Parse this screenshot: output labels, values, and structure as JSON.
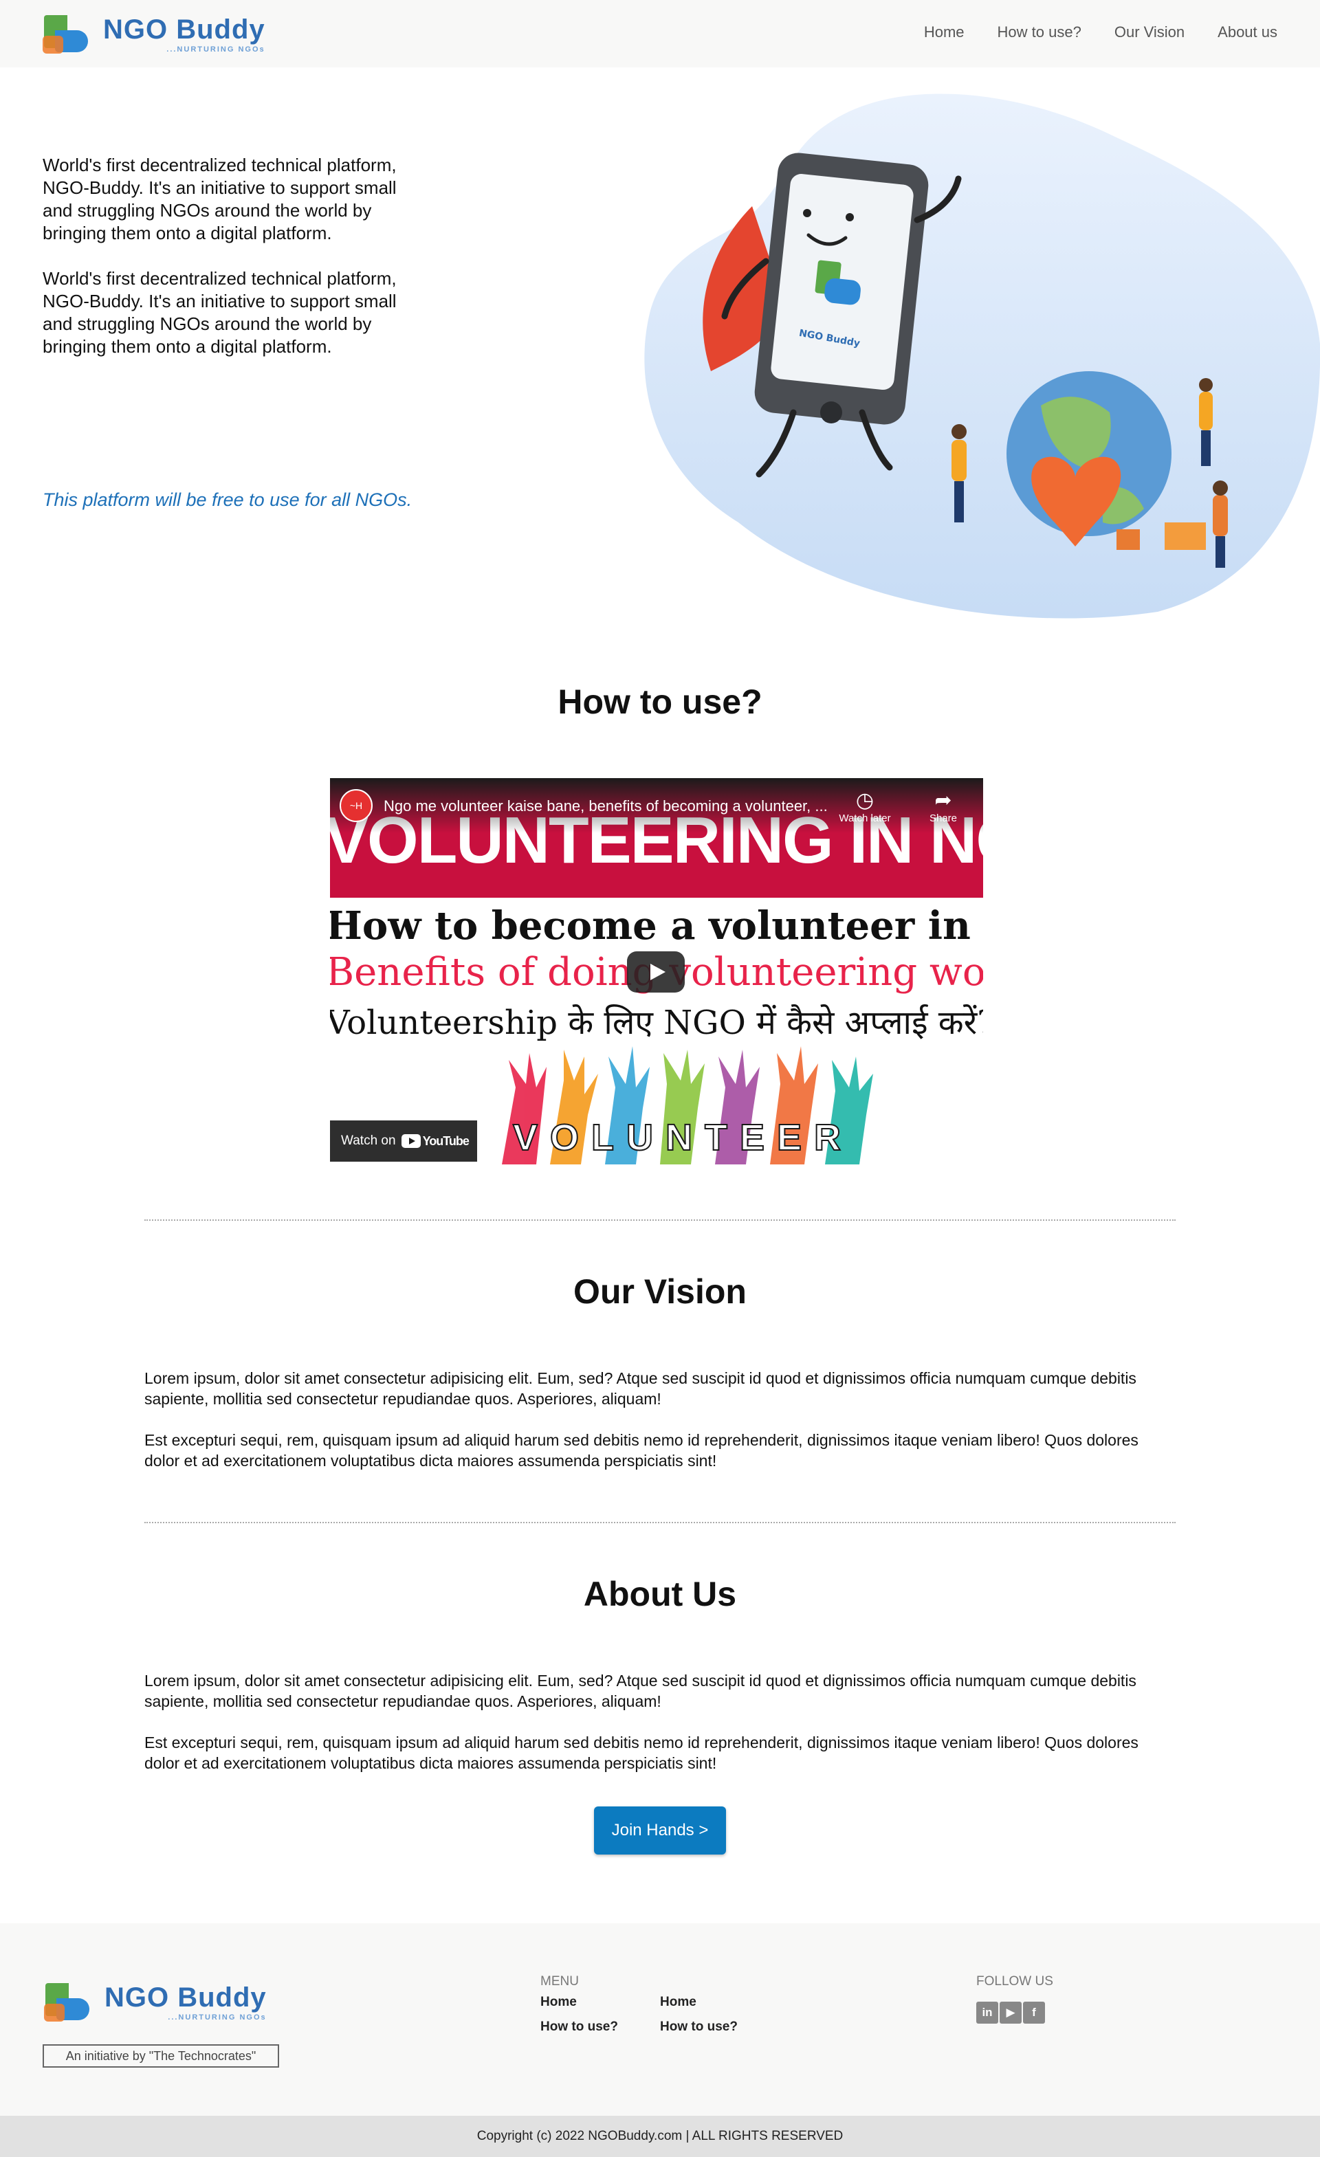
{
  "brand": {
    "name": "NGO Buddy",
    "tagline": "...NURTURING NGOs"
  },
  "nav": {
    "items": [
      {
        "label": "Home"
      },
      {
        "label": "How to use?"
      },
      {
        "label": "Our Vision"
      },
      {
        "label": "About us"
      }
    ]
  },
  "hero": {
    "para1": "World's first decentralized technical platform, NGO-Buddy. It's an initiative to support small and struggling NGOs around the world by bringing them onto a digital platform.",
    "para2": "World's first decentralized technical platform, NGO-Buddy. It's an initiative to support small and struggling NGOs around the world by bringing them onto a digital platform.",
    "free_note": "This platform will be free to use for all NGOs.",
    "phone_brand": "NGO Buddy"
  },
  "how_to_use": {
    "title": "How to use?",
    "video": {
      "title": "Ngo me volunteer kaise bane, benefits of becoming a volunteer, ...",
      "watch_later": "Watch later",
      "share": "Share",
      "headline": "VOLUNTEERING IN NGO",
      "line1": "How to become a volunteer in NGO?",
      "line2": "Benefits of doing volunteering work",
      "line3": "Volunteership के लिए NGO में कैसे अप्लाई करें?",
      "word": "VOLUNTEER",
      "watch_on": "Watch on",
      "youtube": "YouTube"
    }
  },
  "vision": {
    "title": "Our Vision",
    "para1": "Lorem ipsum, dolor sit amet consectetur adipisicing elit. Eum, sed? Atque sed suscipit id quod et dignissimos officia numquam cumque debitis sapiente, mollitia sed consectetur repudiandae quos. Asperiores, aliquam!",
    "para2": "Est excepturi sequi, rem, quisquam ipsum ad aliquid harum sed debitis nemo id reprehenderit, dignissimos itaque veniam libero! Quos dolores dolor et ad exercitationem voluptatibus dicta maiores assumenda perspiciatis sint!"
  },
  "about": {
    "title": "About Us",
    "para1": "Lorem ipsum, dolor sit amet consectetur adipisicing elit. Eum, sed? Atque sed suscipit id quod et dignissimos officia numquam cumque debitis sapiente, mollitia sed consectetur repudiandae quos. Asperiores, aliquam!",
    "para2": "Est excepturi sequi, rem, quisquam ipsum ad aliquid harum sed debitis nemo id reprehenderit, dignissimos itaque veniam libero! Quos dolores dolor et ad exercitationem voluptatibus dicta maiores assumenda perspiciatis sint!",
    "cta": "Join Hands >"
  },
  "footer": {
    "initiative": "An initiative by \"The Technocrates\"",
    "menu_heading": "MENU",
    "menu_col1": [
      "Home",
      "How to use?"
    ],
    "menu_col2": [
      "Home",
      "How to use?"
    ],
    "follow_heading": "FOLLOW US",
    "social": [
      {
        "icon": "linkedin-icon",
        "glyph": "in"
      },
      {
        "icon": "youtube-icon",
        "glyph": "▶"
      },
      {
        "icon": "facebook-icon",
        "glyph": "f"
      }
    ],
    "copyright": "Copyright (c) 2022 NGOBuddy.com | ALL RIGHTS RESERVED"
  },
  "colors": {
    "accent": "#0c7bc0",
    "link_blue": "#1d70b8",
    "nav_bg": "#f8f8f7",
    "footer_bar": "#e1e1e1"
  }
}
